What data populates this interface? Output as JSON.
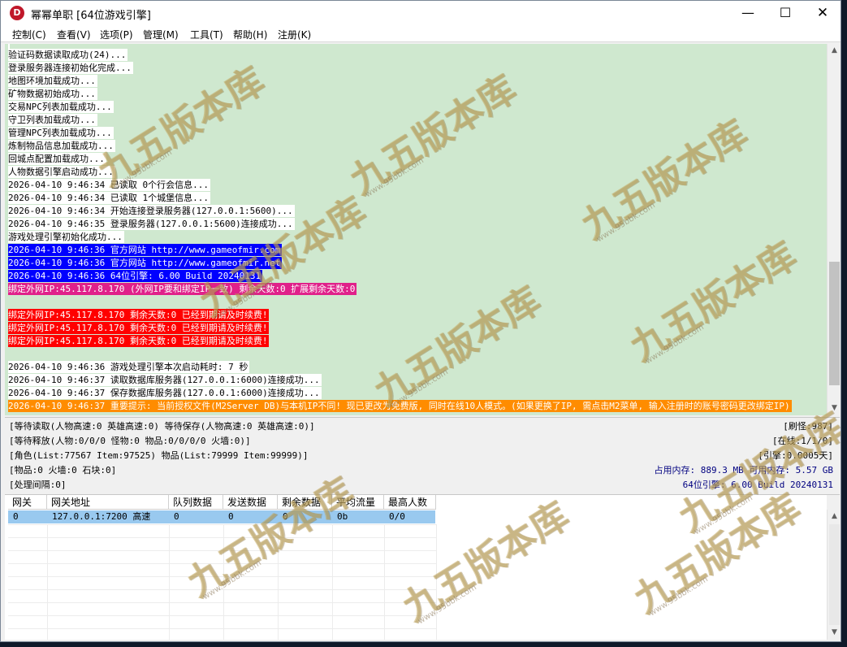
{
  "window": {
    "title": "幂幂单职 [64位游戏引擎]",
    "icon_letter": "D",
    "minimize": "—",
    "maximize": "☐",
    "close": "✕"
  },
  "menu": [
    "控制(C)",
    "查看(V)",
    "选项(P)",
    "管理(M)",
    "工具(T)",
    "帮助(H)",
    "注册(K)"
  ],
  "log": [
    {
      "text": "验证码数据读取成功(24)...",
      "style": "w"
    },
    {
      "text": "登录服务器连接初始化完成...",
      "style": "w"
    },
    {
      "text": "地图环境加载成功...",
      "style": "w"
    },
    {
      "text": "矿物数据初始成功...",
      "style": "w"
    },
    {
      "text": "交易NPC列表加载成功...",
      "style": "w"
    },
    {
      "text": "守卫列表加载成功...",
      "style": "w"
    },
    {
      "text": "管理NPC列表加载成功...",
      "style": "w"
    },
    {
      "text": "炼制物品信息加载成功...",
      "style": "w"
    },
    {
      "text": "回城点配置加载成功...",
      "style": "w"
    },
    {
      "text": "人物数据引擎启动成功...",
      "style": "w"
    },
    {
      "text": "2026-04-10 9:46:34 已读取 0个行会信息...",
      "style": "w"
    },
    {
      "text": "2026-04-10 9:46:34 已读取 1个城堡信息...",
      "style": "w"
    },
    {
      "text": "2026-04-10 9:46:34 开始连接登录服务器(127.0.0.1:5600)...",
      "style": "w"
    },
    {
      "text": "2026-04-10 9:46:35 登录服务器(127.0.0.1:5600)连接成功...",
      "style": "w"
    },
    {
      "text": "游戏处理引擎初始化成功...",
      "style": "w"
    },
    {
      "text": "2026-04-10 9:46:36 官方网站 http://www.gameofmir.com",
      "style": "blue"
    },
    {
      "text": "2026-04-10 9:46:36 官方网站 http://www.gameofmir.net",
      "style": "blue"
    },
    {
      "text": "2026-04-10 9:46:36 64位引擎: 6.00 Build 20240131",
      "style": "blue"
    },
    {
      "text": "绑定外网IP:45.117.8.170 (外网IP要和绑定IP一致) 剩余天数:0 扩展剩余天数:0",
      "style": "mag"
    },
    {
      "text": "",
      "style": "none"
    },
    {
      "text": "绑定外网IP:45.117.8.170 剩余天数:0 已经到期请及时续费!",
      "style": "red"
    },
    {
      "text": "绑定外网IP:45.117.8.170 剩余天数:0 已经到期请及时续费!",
      "style": "red"
    },
    {
      "text": "绑定外网IP:45.117.8.170 剩余天数:0 已经到期请及时续费!",
      "style": "red"
    },
    {
      "text": "",
      "style": "none"
    },
    {
      "text": "2026-04-10 9:46:36 游戏处理引擎本次启动耗时: 7 秒",
      "style": "w"
    },
    {
      "text": "2026-04-10 9:46:37 读取数据库服务器(127.0.0.1:6000)连接成功...",
      "style": "w"
    },
    {
      "text": "2026-04-10 9:46:37 保存数据库服务器(127.0.0.1:6000)连接成功...",
      "style": "w"
    },
    {
      "text": "2026-04-10 9:46:37 重要提示: 当前授权文件(M2Server DB)与本机IP不同! 现已更改为免费版, 同时在线10人模式。(如果更换了IP, 需点击M2菜单, 输入注册时的账号密码更改绑定IP)",
      "style": "orange"
    }
  ],
  "status": {
    "line1": "[等待读取(人物高速:0 英雄高速:0) 等待保存(人物高速:0 英雄高速:0)]",
    "line2": "[等待释放(人物:0/0/0 怪物:0 物品:0/0/0/0 火墙:0)]",
    "line3": "[角色(List:77567 Item:97525) 物品(List:79999 Item:99999)]",
    "line4": "[物品:0 火墙:0 石块:0]",
    "line5": "[处理间隔:0]",
    "right1": "[刷怪:987]",
    "right2": "[在线:1/1/0]",
    "right3": "[引擎:0.0005天]",
    "memory": "占用内存: 889.3 MB 可用内存: 5.57 GB",
    "build": "64位引擎: 6.00 Build 20240131"
  },
  "grid": {
    "headers": [
      "网关",
      "网关地址",
      "队列数据",
      "发送数据",
      "剩余数据",
      "平均流量",
      "最高人数"
    ],
    "rows": [
      [
        "0",
        "127.0.0.1:7200 高速",
        "0",
        "0",
        "0",
        "0b",
        "0/0"
      ]
    ]
  },
  "watermark": {
    "text": "九五版本库",
    "sub": "www.95bbk.com"
  },
  "colors": {
    "log_bg": "#cfe8cf",
    "highlight_blue": "#0000ff",
    "highlight_magenta": "#e0218a",
    "highlight_red": "#ff0000",
    "highlight_orange": "#ff8c00",
    "row_selected": "#99c9ef"
  }
}
